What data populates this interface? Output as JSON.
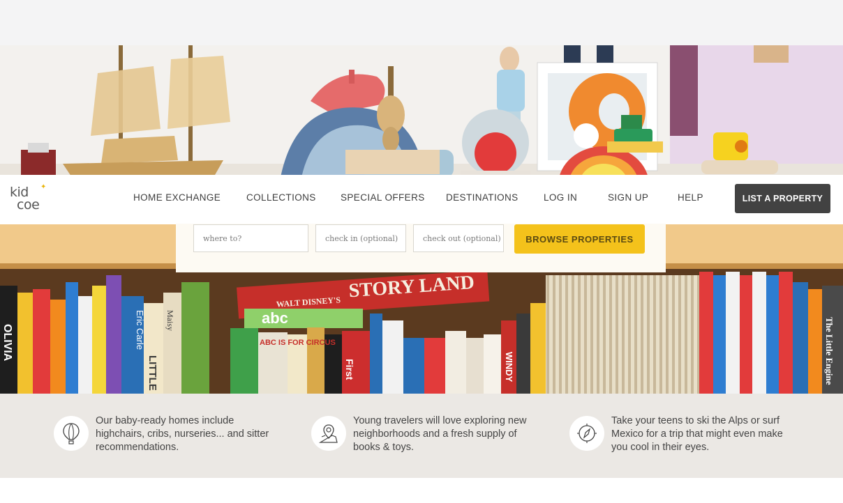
{
  "logo": {
    "line1": "kid",
    "line2": "coe",
    "mark": "logo"
  },
  "nav": {
    "items": [
      {
        "label": "HOME EXCHANGE"
      },
      {
        "label": "COLLECTIONS"
      },
      {
        "label": "SPECIAL OFFERS"
      },
      {
        "label": "DESTINATIONS"
      },
      {
        "label": "LOG IN"
      },
      {
        "label": "SIGN UP"
      },
      {
        "label": "HELP"
      }
    ],
    "cta_label": "LIST A PROPERTY"
  },
  "hero": {
    "book_titles": [
      "STORY LAND",
      "WALT DISNEY'S",
      "abc",
      "ABC IS FOR CIRCUS",
      "Eric Carle",
      "WINDY",
      "OLIVIA",
      "LITTLE",
      "Maisy",
      "First",
      "The Little Engine"
    ]
  },
  "search": {
    "where_placeholder": "where to?",
    "checkin_placeholder": "check in (optional)",
    "checkout_placeholder": "check out (optional)",
    "browse_label": "BROWSE PROPERTIES"
  },
  "features": [
    {
      "icon": "hot-air-balloon-icon",
      "text": "Our baby-ready homes include highchairs, cribs, nurseries... and sitter recommendations."
    },
    {
      "icon": "map-pin-icon",
      "text": "Young travelers will love exploring new neighborhoods and a fresh supply of books & toys."
    },
    {
      "icon": "compass-icon",
      "text": "Take your teens to ski the Alps or surf Mexico for a trip that might even make you cool in their eyes."
    }
  ],
  "colors": {
    "accent_yellow": "#f4c21b",
    "cta_dark": "#424242",
    "feature_band": "#ebe8e4",
    "shelf_wood": "#f1c98a"
  }
}
